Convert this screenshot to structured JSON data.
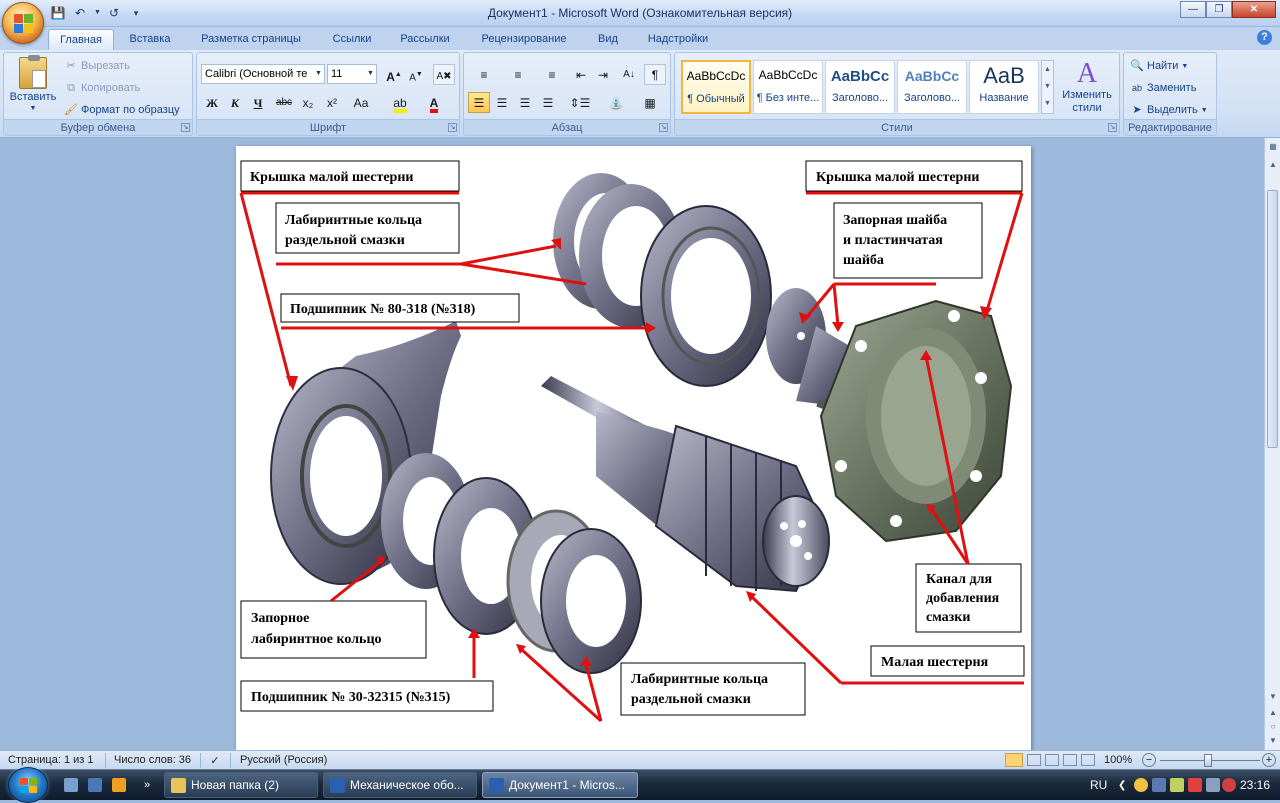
{
  "window": {
    "title": "Документ1 - Microsoft Word (Ознакомительная версия)"
  },
  "tabs": [
    {
      "label": "Главная",
      "active": true
    },
    {
      "label": "Вставка"
    },
    {
      "label": "Разметка страницы"
    },
    {
      "label": "Ссылки"
    },
    {
      "label": "Рассылки"
    },
    {
      "label": "Рецензирование"
    },
    {
      "label": "Вид"
    },
    {
      "label": "Надстройки"
    }
  ],
  "clipboard": {
    "paste": "Вставить",
    "cut": "Вырезать",
    "copy": "Копировать",
    "format_painter": "Формат по образцу",
    "label": "Буфер обмена"
  },
  "font": {
    "name": "Calibri (Основной те",
    "size": "11",
    "label": "Шрифт",
    "bold": "Ж",
    "italic": "К",
    "underline": "Ч",
    "strike": "abc",
    "subscript": "x₂",
    "superscript": "x²",
    "case": "Аа"
  },
  "paragraph": {
    "label": "Абзац"
  },
  "styles": {
    "label": "Стили",
    "items": [
      {
        "sample": "AaBbCcDc",
        "name": "¶ Обычный",
        "selected": true
      },
      {
        "sample": "AaBbCcDc",
        "name": "¶ Без инте..."
      },
      {
        "sample": "AaBbCc",
        "name": "Заголово..."
      },
      {
        "sample": "AaBbCc",
        "name": "Заголово..."
      },
      {
        "sample": "AaB",
        "name": "Название"
      }
    ],
    "change": "Изменить стили"
  },
  "editing": {
    "find": "Найти",
    "replace": "Заменить",
    "select": "Выделить",
    "label": "Редактирование"
  },
  "diagram": {
    "labels": {
      "cover_left": "Крышка малой шестерни",
      "cover_right": "Крышка малой шестерни",
      "lab_rings_top_1": "Лабиринтные кольца",
      "lab_rings_top_2": "раздельной смазки",
      "lock_washer_1": "Запорная шайба",
      "lock_washer_2": "и пластинчатая",
      "lock_washer_3": "шайба",
      "bearing_318": "Подшипник № 80-318 (№318)",
      "lock_ring_1": "Запорное",
      "lock_ring_2": "лабиринтное кольцо",
      "bearing_315": "Подшипник № 30-32315 (№315)",
      "lab_rings_bottom_1": "Лабиринтные кольца",
      "lab_rings_bottom_2": "раздельной смазки",
      "channel_1": "Канал для",
      "channel_2": "добавления",
      "channel_3": "смазки",
      "small_gear": "Малая шестерня"
    },
    "arrow_color": "#e01010"
  },
  "status": {
    "page": "Страница: 1 из 1",
    "words": "Число слов: 36",
    "lang": "Русский (Россия)",
    "zoom": "100%"
  },
  "taskbar": {
    "items": [
      {
        "label": "Новая папка (2)"
      },
      {
        "label": "Механическое обо..."
      },
      {
        "label": "Документ1 - Micros...",
        "active": true
      }
    ],
    "lang": "RU",
    "time": "23:16"
  }
}
